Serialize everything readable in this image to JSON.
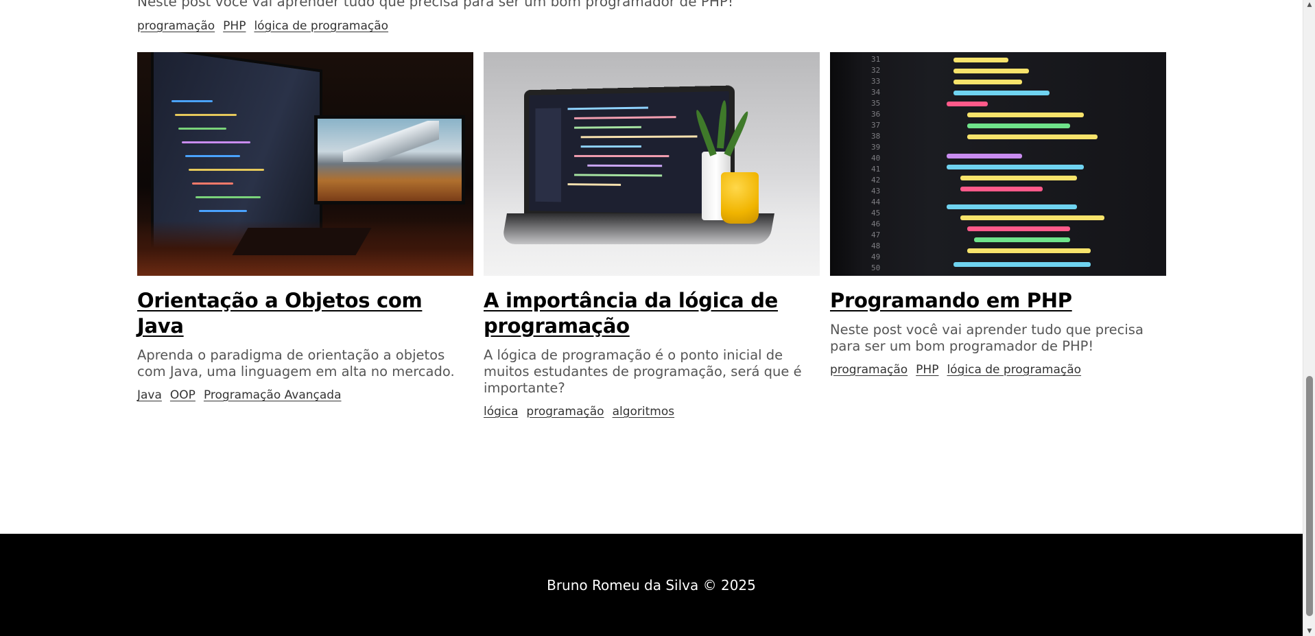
{
  "top_post": {
    "description": "Neste post você vai aprender tudo que precisa para ser um bom programador de PHP!",
    "tags": [
      "programação",
      "PHP",
      "lógica de programação"
    ]
  },
  "posts": [
    {
      "title": "Orientação a Objetos com Java",
      "description": "Aprenda o paradigma de orientação a objetos com Java, uma linguagem em alta no mercado.",
      "tags": [
        "Java",
        "OOP",
        "Programação Avançada"
      ],
      "image": "dual-monitor-code-image"
    },
    {
      "title": "A importância da lógica de programação",
      "description": "A lógica de programação é o ponto inicial de muitos estudantes de programação, será que é importante?",
      "tags": [
        "lógica",
        "programação",
        "algoritmos"
      ],
      "image": "laptop-code-image"
    },
    {
      "title": "Programando em PHP",
      "description": "Neste post você vai aprender tudo que precisa para ser um bom programador de PHP!",
      "tags": [
        "programação",
        "PHP",
        "lógica de programação"
      ],
      "image": "code-closeup-image"
    }
  ],
  "footer": {
    "text": "Bruno Romeu da Silva © 2025"
  },
  "colors": {
    "footer_bg": "#000000",
    "text_muted": "#555555"
  }
}
